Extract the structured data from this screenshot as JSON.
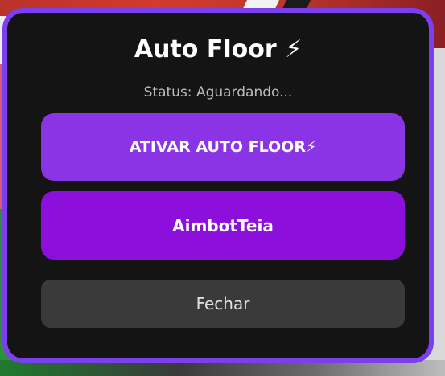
{
  "panel": {
    "title": "Auto Floor ⚡",
    "status": "Status: Aguardando..."
  },
  "buttons": {
    "ativar_label": "ATIVAR AUTO FLOOR⚡",
    "aimbot_label": "AimbotTeia",
    "fechar_label": "Fechar"
  },
  "colors": {
    "border_accent": "#7b3ff0",
    "ativar_button": "#8a34e6",
    "aimbot_button": "#8c0fdc",
    "fechar_button": "#3a3a3a",
    "panel_background": "#141414"
  }
}
